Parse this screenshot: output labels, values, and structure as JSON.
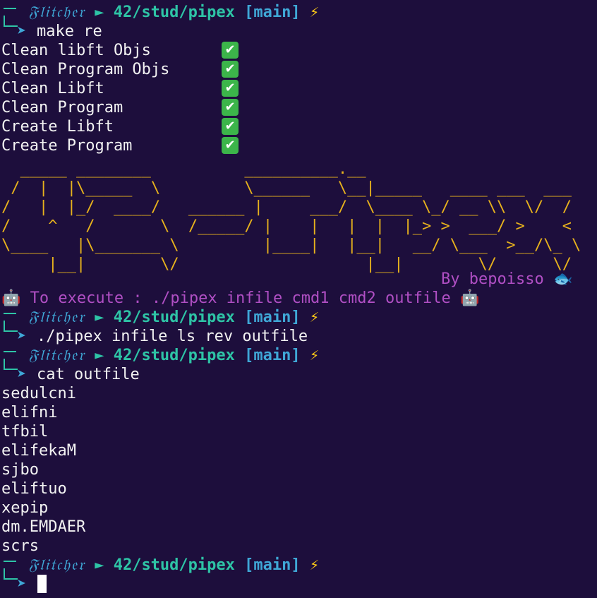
{
  "prompt": {
    "user": "𝔉𝔩𝔦𝔱𝔠𝔥𝔢𝔯",
    "arrow": "►",
    "path": "42/stud/pipex",
    "branch_open": "[",
    "branch": "main",
    "branch_close": "]",
    "bolt": "⚡",
    "chevron": "➤",
    "sep": " "
  },
  "commands": {
    "make": "make re",
    "run": "./pipex infile ls rev outfile",
    "cat": "cat outfile"
  },
  "make_output": [
    {
      "label": "Clean libft Objs",
      "status": "✔"
    },
    {
      "label": "Clean Program Objs",
      "status": "✔"
    },
    {
      "label": "Clean Libft",
      "status": "✔"
    },
    {
      "label": "Clean Program",
      "status": "✔"
    },
    {
      "label": "Create Libft",
      "status": "✔"
    },
    {
      "label": "Create Program",
      "status": "✔"
    }
  ],
  "banner": {
    "ascii": "  _____ ________          __________.__                \n /  |  |\\_____  \\         \\______   \\__|_____   ____ ___  ___\n/   |  |_/  ____/   ______ |     ___/  \\____ \\_/ __ \\\\  \\/  /\n/    ^   /       \\  /_____/ |    |   |  |  |_> >  ___/ >    <\n\\____   |\\_______ \\         |____|   |__|   __/ \\___  >__/\\_ \\\n     |__|        \\/                    |__|        \\/      \\/",
    "byline": "By bepoisso",
    "byline_emoji": "🐟",
    "exec_emoji": "🤖",
    "exec_text": "To execute : ./pipex infile cmd1 cmd2 outfile"
  },
  "cat_output": [
    "sedulcni",
    "elifni",
    "tfbil",
    "elifekaM",
    "sjbo",
    "eliftuo",
    "xepip",
    "dm.EMDAER",
    "scrs"
  ],
  "colors": {
    "background": "#1d0e3c",
    "prompt_teal": "#2ec4a6",
    "prompt_blue": "#3fa7d6",
    "ascii_gold": "#e7b21d",
    "magenta": "#b04fc4",
    "check_green": "#3cb54a"
  }
}
